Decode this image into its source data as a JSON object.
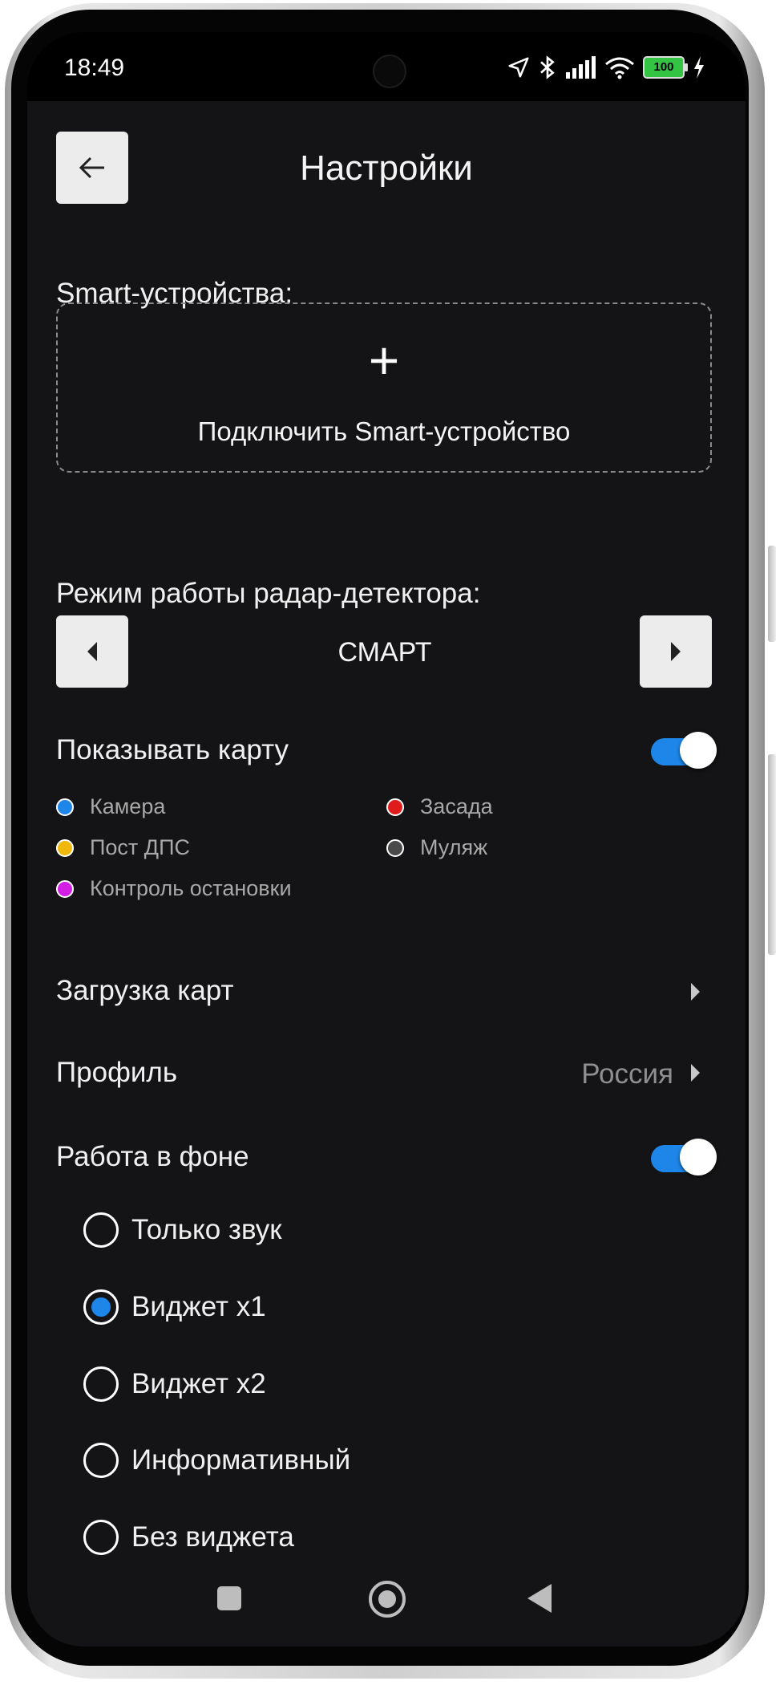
{
  "status_bar": {
    "time": "18:49",
    "battery": "100"
  },
  "header": {
    "title": "Настройки"
  },
  "smart_devices": {
    "label": "Smart-устройства:",
    "add_icon": "+",
    "add_label": "Подключить Smart-устройство"
  },
  "radar_mode": {
    "label": "Режим работы радар-детектора:",
    "value": "СМАРТ"
  },
  "show_map": {
    "label": "Показывать карту",
    "enabled": true,
    "legend": [
      {
        "label": "Камера",
        "color": "#1d86e8"
      },
      {
        "label": "Засада",
        "color": "#e01b1b"
      },
      {
        "label": "Пост ДПС",
        "color": "#f0b80c"
      },
      {
        "label": "Муляж",
        "color": "#4a4a4a"
      },
      {
        "label": "Контроль остановки",
        "color": "#d31ee3"
      }
    ]
  },
  "map_download": {
    "label": "Загрузка карт"
  },
  "profile": {
    "label": "Профиль",
    "value": "Россия"
  },
  "background": {
    "label": "Работа в фоне",
    "enabled": true,
    "options": [
      {
        "label": "Только звук",
        "selected": false
      },
      {
        "label": "Виджет x1",
        "selected": true
      },
      {
        "label": "Виджет x2",
        "selected": false
      },
      {
        "label": "Информативный",
        "selected": false
      },
      {
        "label": "Без виджета",
        "selected": false
      }
    ]
  },
  "icons": [
    "arrow-left-icon",
    "plus-icon",
    "caret-left-icon",
    "caret-right-icon",
    "chevron-right-icon",
    "location-icon",
    "bluetooth-icon",
    "signal-icon",
    "wifi-icon",
    "battery-icon",
    "charging-icon"
  ],
  "colors": {
    "accent": "#1d86e8",
    "background": "#141416",
    "button": "#ececec"
  }
}
